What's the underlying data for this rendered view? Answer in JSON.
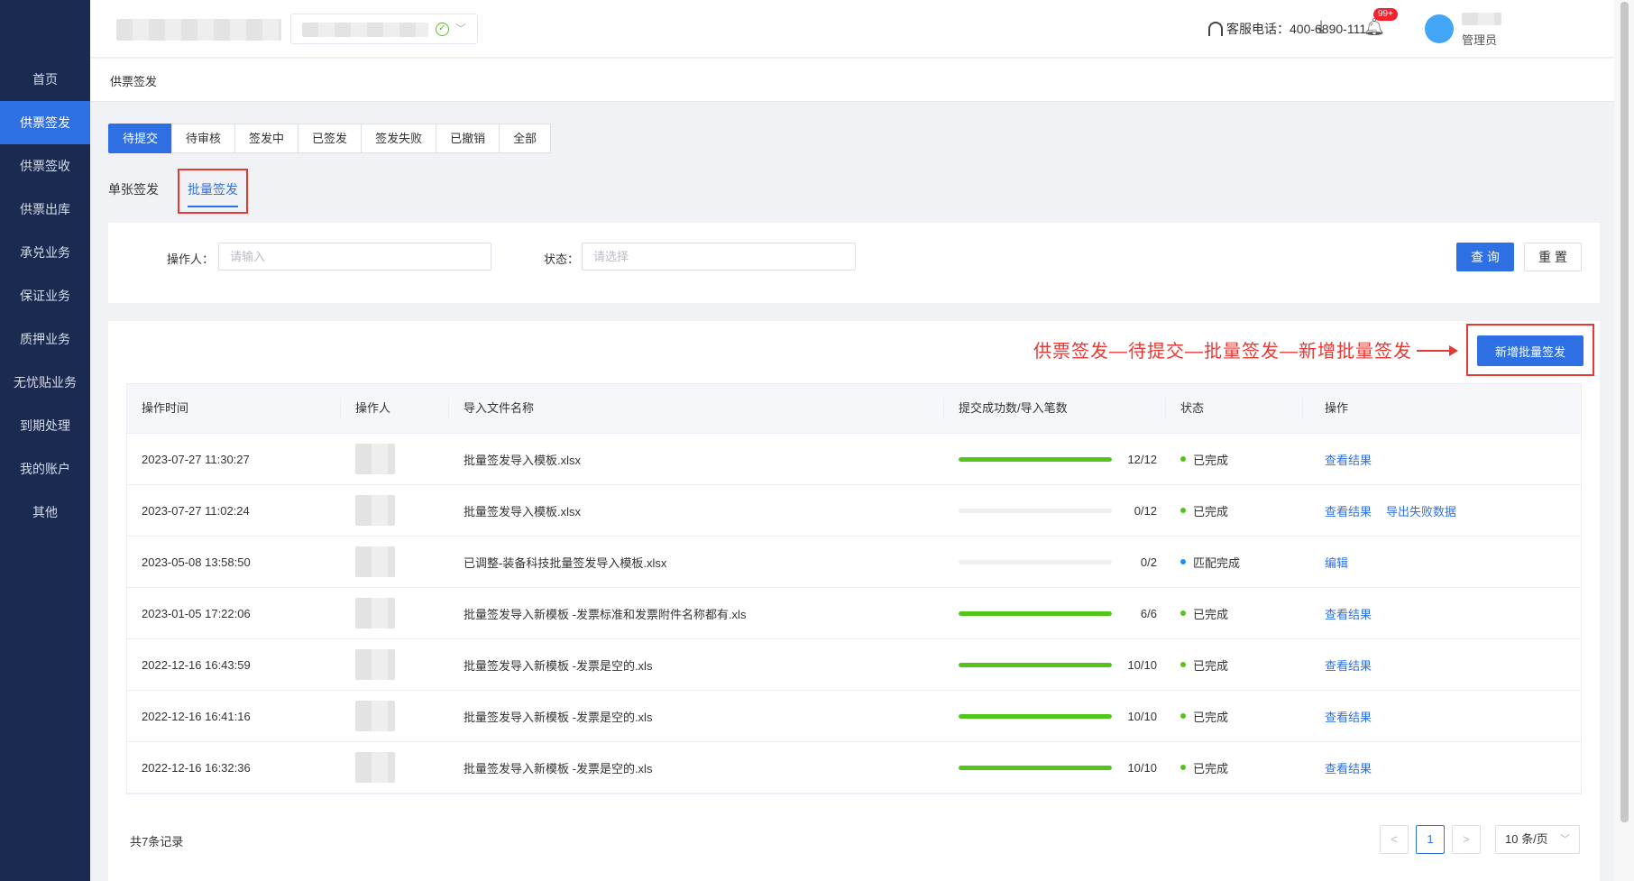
{
  "sidebar": {
    "items": [
      {
        "label": "首页",
        "active": false
      },
      {
        "label": "供票签发",
        "active": true
      },
      {
        "label": "供票签收",
        "active": false
      },
      {
        "label": "供票出库",
        "active": false
      },
      {
        "label": "承兑业务",
        "active": false
      },
      {
        "label": "保证业务",
        "active": false
      },
      {
        "label": "质押业务",
        "active": false
      },
      {
        "label": "无忧贴业务",
        "active": false
      },
      {
        "label": "到期处理",
        "active": false
      },
      {
        "label": "我的账户",
        "active": false
      },
      {
        "label": "其他",
        "active": false
      }
    ]
  },
  "header": {
    "hotline": "客服电话：400-6890-111",
    "badge": "99+",
    "user_role": "管理员",
    "icons": [
      "headset-icon",
      "download-icon",
      "bell-icon",
      "check-circle-icon",
      "chevron-down-icon"
    ]
  },
  "breadcrumb": "供票签发",
  "status_tabs": [
    "待提交",
    "待审核",
    "签发中",
    "已签发",
    "签发失败",
    "已撤销",
    "全部"
  ],
  "sub_tabs": {
    "single": "单张签发",
    "batch": "批量签发"
  },
  "filter": {
    "operator_label": "操作人：",
    "operator_placeholder": "请输入",
    "status_label": "状态：",
    "status_placeholder": "请选择",
    "query": "查 询",
    "reset": "重 置"
  },
  "annotation": "供票签发—待提交—批量签发—新增批量签发",
  "add_button": "新增批量签发",
  "table": {
    "headers": [
      "操作时间",
      "操作人",
      "导入文件名称",
      "提交成功数/导入笔数",
      "状态",
      "操作"
    ],
    "rows": [
      {
        "time": "2023-07-27 11:30:27",
        "file": "批量签发导入模板.xlsx",
        "progress": 1.0,
        "count": "12/12",
        "status": "已完成",
        "status_color": "#52c41a",
        "actions": [
          "查看结果"
        ]
      },
      {
        "time": "2023-07-27 11:02:24",
        "file": "批量签发导入模板.xlsx",
        "progress": 0.0,
        "count": "0/12",
        "status": "已完成",
        "status_color": "#52c41a",
        "actions": [
          "查看结果",
          "导出失败数据"
        ]
      },
      {
        "time": "2023-05-08 13:58:50",
        "file": "已调整-装备科技批量签发导入模板.xlsx",
        "progress": 0.0,
        "count": "0/2",
        "status": "匹配完成",
        "status_color": "#1890ff",
        "actions": [
          "编辑"
        ]
      },
      {
        "time": "2023-01-05 17:22:06",
        "file": "批量签发导入新模板 -发票标准和发票附件名称都有.xls",
        "progress": 1.0,
        "count": "6/6",
        "status": "已完成",
        "status_color": "#52c41a",
        "actions": [
          "查看结果"
        ]
      },
      {
        "time": "2022-12-16 16:43:59",
        "file": "批量签发导入新模板 -发票是空的.xls",
        "progress": 1.0,
        "count": "10/10",
        "status": "已完成",
        "status_color": "#52c41a",
        "actions": [
          "查看结果"
        ]
      },
      {
        "time": "2022-12-16 16:41:16",
        "file": "批量签发导入新模板 -发票是空的.xls",
        "progress": 1.0,
        "count": "10/10",
        "status": "已完成",
        "status_color": "#52c41a",
        "actions": [
          "查看结果"
        ]
      },
      {
        "time": "2022-12-16 16:32:36",
        "file": "批量签发导入新模板 -发票是空的.xls",
        "progress": 1.0,
        "count": "10/10",
        "status": "已完成",
        "status_color": "#52c41a",
        "actions": [
          "查看结果"
        ]
      }
    ]
  },
  "pagination": {
    "total": "共7条记录",
    "current": "1",
    "prev": "<",
    "next": ">",
    "page_size": "10 条/页"
  },
  "colors": {
    "primary": "#2f6fe4",
    "sidebar": "#1b2a50",
    "success": "#52c41a",
    "annotation": "#e53935"
  }
}
